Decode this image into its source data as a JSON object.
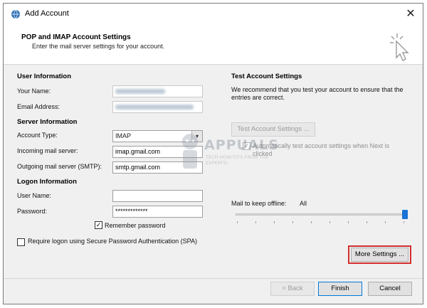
{
  "window": {
    "title": "Add Account",
    "close_glyph": "✕",
    "banner_title": "POP and IMAP Account Settings",
    "banner_subtitle": "Enter the mail server settings for your account."
  },
  "user_info": {
    "section": "User Information",
    "name_label": "Your Name:",
    "email_label": "Email Address:"
  },
  "server_info": {
    "section": "Server Information",
    "account_type_label": "Account Type:",
    "account_type_value": "IMAP",
    "incoming_label": "Incoming mail server:",
    "incoming_value": "imap.gmail.com",
    "outgoing_label": "Outgoing mail server (SMTP):",
    "outgoing_value": "smtp.gmail.com"
  },
  "logon_info": {
    "section": "Logon Information",
    "username_label": "User Name:",
    "username_value": "",
    "password_label": "Password:",
    "password_value": "*************",
    "remember_label": "Remember password",
    "remember_checked": "✓",
    "spa_label": "Require logon using Secure Password Authentication (SPA)"
  },
  "test": {
    "section": "Test Account Settings",
    "description": "We recommend that you test your account to ensure that the entries are correct.",
    "test_button": "Test Account Settings ...",
    "auto_test_label": "Automatically test account settings when Next is clicked",
    "auto_test_checked": "✓"
  },
  "offline": {
    "label": "Mail to keep offline:",
    "value": "All",
    "slider_fraction": 1.0
  },
  "buttons": {
    "more_settings": "More Settings ...",
    "back": "< Back",
    "finish": "Finish",
    "cancel": "Cancel"
  },
  "watermark": {
    "brand": "APPUALS",
    "tagline": "TECH HOW-TO'S FROM THE EXPERTS!"
  },
  "icons": {
    "app": "outlook-globe-icon",
    "banner": "cursor-click-icon"
  },
  "colors": {
    "accent": "#0078d7",
    "highlight": "#d32f2f",
    "slider": "#1a73d6"
  }
}
